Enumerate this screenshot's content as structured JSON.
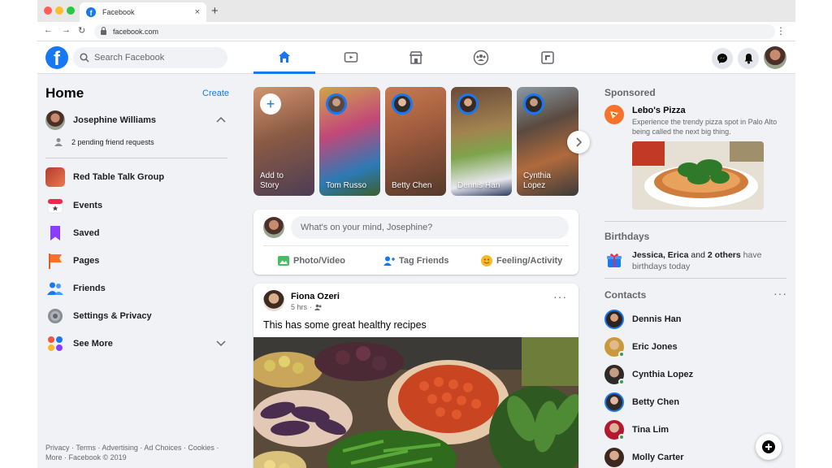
{
  "browser": {
    "tab_title": "Facebook",
    "url": "facebook.com",
    "favicon_letter": "f"
  },
  "header": {
    "logo_letter": "f",
    "search_placeholder": "Search Facebook",
    "nav_tabs": [
      "home-icon",
      "watch-icon",
      "marketplace-icon",
      "groups-icon",
      "gaming-icon"
    ],
    "active_tab": "home-icon",
    "accent_color": "#1877f2"
  },
  "sidebar": {
    "home_title": "Home",
    "create_label": "Create",
    "profile_name": "Josephine Williams",
    "friend_requests": "2 pending friend requests",
    "items": [
      {
        "label": "Red Table Talk Group",
        "icon": "group-photo-icon"
      },
      {
        "label": "Events",
        "icon": "calendar-icon"
      },
      {
        "label": "Saved",
        "icon": "bookmark-icon"
      },
      {
        "label": "Pages",
        "icon": "flag-icon"
      },
      {
        "label": "Friends",
        "icon": "friends-icon"
      },
      {
        "label": "Settings & Privacy",
        "icon": "gear-icon"
      },
      {
        "label": "See More",
        "icon": "see-more-icon"
      }
    ],
    "footer": "Privacy · Terms · Advertising · Ad Choices · Cookies · More · Facebook © 2019"
  },
  "stories": [
    {
      "name": "Add to Story"
    },
    {
      "name": "Tom Russo"
    },
    {
      "name": "Betty Chen"
    },
    {
      "name": "Dennis Han"
    },
    {
      "name": "Cynthia Lopez"
    }
  ],
  "composer": {
    "placeholder": "What's on your mind, Josephine?",
    "actions": [
      "Photo/Video",
      "Tag Friends",
      "Feeling/Activity"
    ]
  },
  "post": {
    "author": "Fiona Ozeri",
    "time": "5 hrs",
    "text": "This has some great healthy recipes"
  },
  "sponsored": {
    "title": "Sponsored",
    "advertiser": "Lebo's Pizza",
    "description": "Experience the trendy pizza spot in Palo Alto being called the next big thing."
  },
  "birthdays": {
    "title": "Birthdays",
    "names": "Jessica, Erica",
    "and": "and",
    "others": "2 others",
    "rest": "have birthdays today"
  },
  "contacts": {
    "title": "Contacts",
    "list": [
      "Dennis Han",
      "Eric Jones",
      "Cynthia Lopez",
      "Betty Chen",
      "Tina Lim",
      "Molly Carter"
    ]
  }
}
